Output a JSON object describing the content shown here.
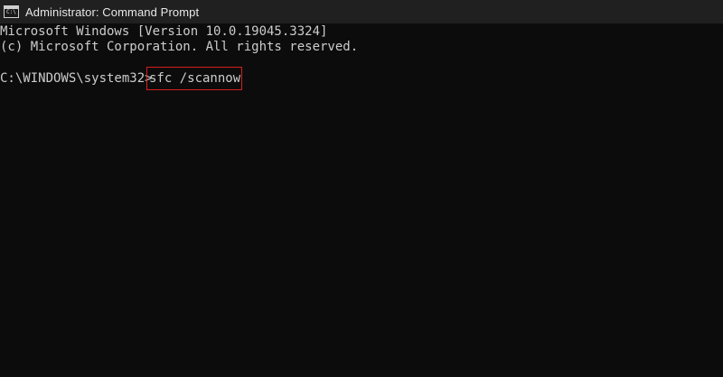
{
  "window": {
    "title": "Administrator: Command Prompt",
    "icon": "cmd-console-icon",
    "icon_glyph": "C:\\"
  },
  "console": {
    "lines": [
      "Microsoft Windows [Version 10.0.19045.3324]",
      "(c) Microsoft Corporation. All rights reserved."
    ],
    "prompt": "C:\\WINDOWS\\system32>",
    "command": "sfc /scannow",
    "highlight_color": "#d81e1e",
    "background_color": "#0c0c0c",
    "text_color": "#cccccc"
  }
}
